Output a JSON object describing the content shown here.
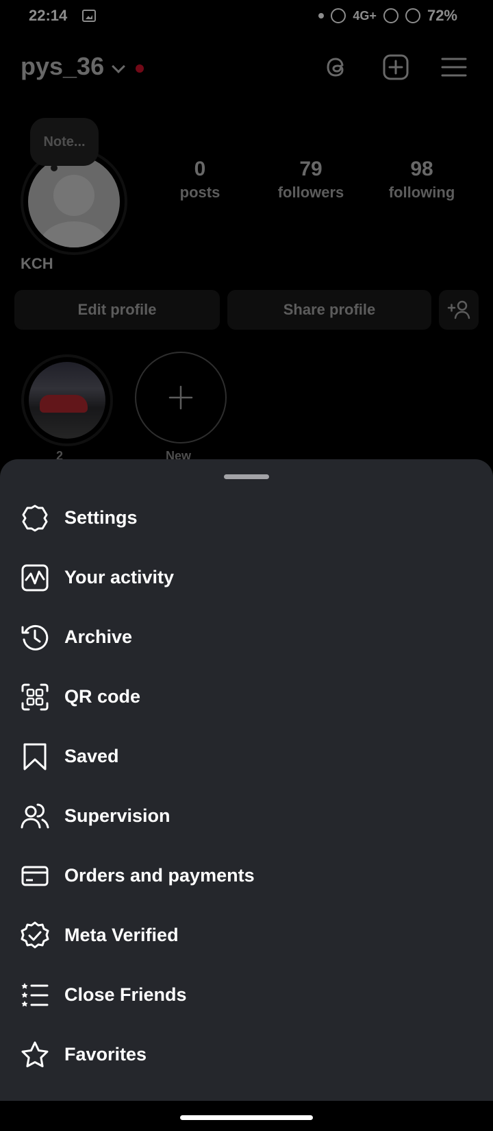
{
  "status_bar": {
    "time": "22:14",
    "network": "4G+",
    "battery": "72%"
  },
  "profile": {
    "username": "pys_36",
    "note_placeholder": "Note...",
    "display_name": "KCH",
    "stats": [
      {
        "value": "0",
        "label": "posts"
      },
      {
        "value": "79",
        "label": "followers"
      },
      {
        "value": "98",
        "label": "following"
      }
    ],
    "buttons": {
      "edit": "Edit profile",
      "share": "Share profile"
    },
    "highlights": [
      {
        "label": "2"
      },
      {
        "label": "New"
      }
    ]
  },
  "menu": {
    "items": [
      {
        "label": "Settings",
        "icon": "settings-icon"
      },
      {
        "label": "Your activity",
        "icon": "activity-icon"
      },
      {
        "label": "Archive",
        "icon": "archive-icon"
      },
      {
        "label": "QR code",
        "icon": "qr-code-icon"
      },
      {
        "label": "Saved",
        "icon": "bookmark-icon"
      },
      {
        "label": "Supervision",
        "icon": "supervision-icon"
      },
      {
        "label": "Orders and payments",
        "icon": "card-icon"
      },
      {
        "label": "Meta Verified",
        "icon": "verified-badge-icon"
      },
      {
        "label": "Close Friends",
        "icon": "close-friends-icon"
      },
      {
        "label": "Favorites",
        "icon": "star-icon"
      }
    ]
  },
  "colors": {
    "sheet_bg": "#25272c",
    "accent_red": "#d0112b"
  }
}
